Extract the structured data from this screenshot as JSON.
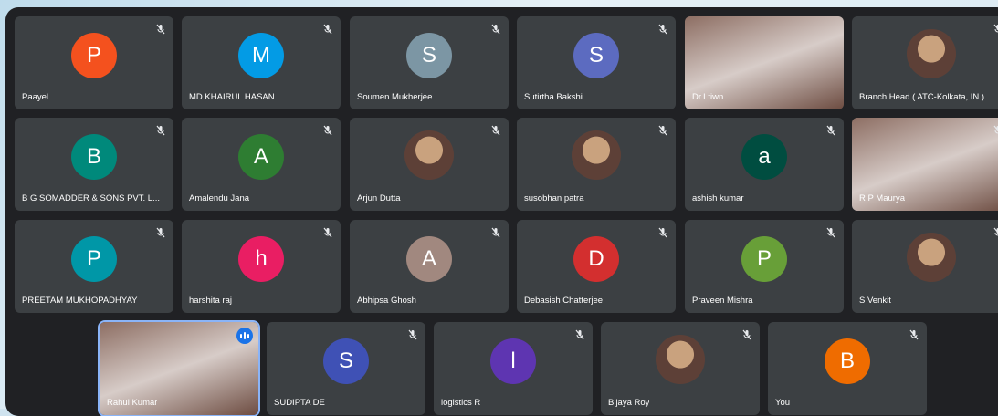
{
  "colors": {
    "bg": "#202124",
    "tile": "#3c4043",
    "accent": "#8ab4f8"
  },
  "participants": [
    {
      "name": "Paayel",
      "initial": "P",
      "color": "#f4511e",
      "muted": true
    },
    {
      "name": "MD KHAIRUL HASAN",
      "initial": "M",
      "color": "#039be5",
      "muted": true
    },
    {
      "name": "Soumen Mukherjee",
      "initial": "S",
      "color": "#7c96a4",
      "muted": true
    },
    {
      "name": "Sutirtha Bakshi",
      "initial": "S",
      "color": "#5c6bc0",
      "muted": true
    },
    {
      "name": "Dr.Ltiwn",
      "type": "video",
      "muted": false
    },
    {
      "name": "Branch Head ( ATC-Kolkata, IN )",
      "type": "photo",
      "muted": true
    },
    {
      "name": "B G SOMADDER & SONS PVT. L...",
      "initial": "B",
      "color": "#00897b",
      "muted": true
    },
    {
      "name": "Amalendu Jana",
      "initial": "A",
      "color": "#2e7d32",
      "muted": true
    },
    {
      "name": "Arjun Dutta",
      "type": "photo",
      "muted": true
    },
    {
      "name": "susobhan patra",
      "type": "photo",
      "muted": true
    },
    {
      "name": "ashish kumar",
      "initial": "a",
      "color": "#004d40",
      "muted": true
    },
    {
      "name": "R P Maurya",
      "type": "video",
      "muted": true
    },
    {
      "name": "PREETAM MUKHOPADHYAY",
      "initial": "P",
      "color": "#0097a7",
      "muted": true
    },
    {
      "name": "harshita raj",
      "initial": "h",
      "color": "#e91e63",
      "muted": true
    },
    {
      "name": "Abhipsa Ghosh",
      "initial": "A",
      "color": "#a1887f",
      "muted": true
    },
    {
      "name": "Debasish Chatterjee",
      "initial": "D",
      "color": "#d32f2f",
      "muted": true
    },
    {
      "name": "Praveen Mishra",
      "initial": "P",
      "color": "#689f38",
      "muted": true
    },
    {
      "name": "S Venkit",
      "type": "photo",
      "muted": true
    },
    {
      "name": "Rahul Kumar",
      "type": "video",
      "muted": false,
      "speaking": true
    },
    {
      "name": "SUDIPTA DE",
      "initial": "S",
      "color": "#3f51b5",
      "muted": true
    },
    {
      "name": "logistics R",
      "initial": "l",
      "color": "#5e35b1",
      "muted": true
    },
    {
      "name": "Bijaya Roy",
      "type": "photo",
      "muted": true,
      "pinned": true
    },
    {
      "name": "You",
      "initial": "B",
      "color": "#ef6c00",
      "muted": true
    }
  ]
}
